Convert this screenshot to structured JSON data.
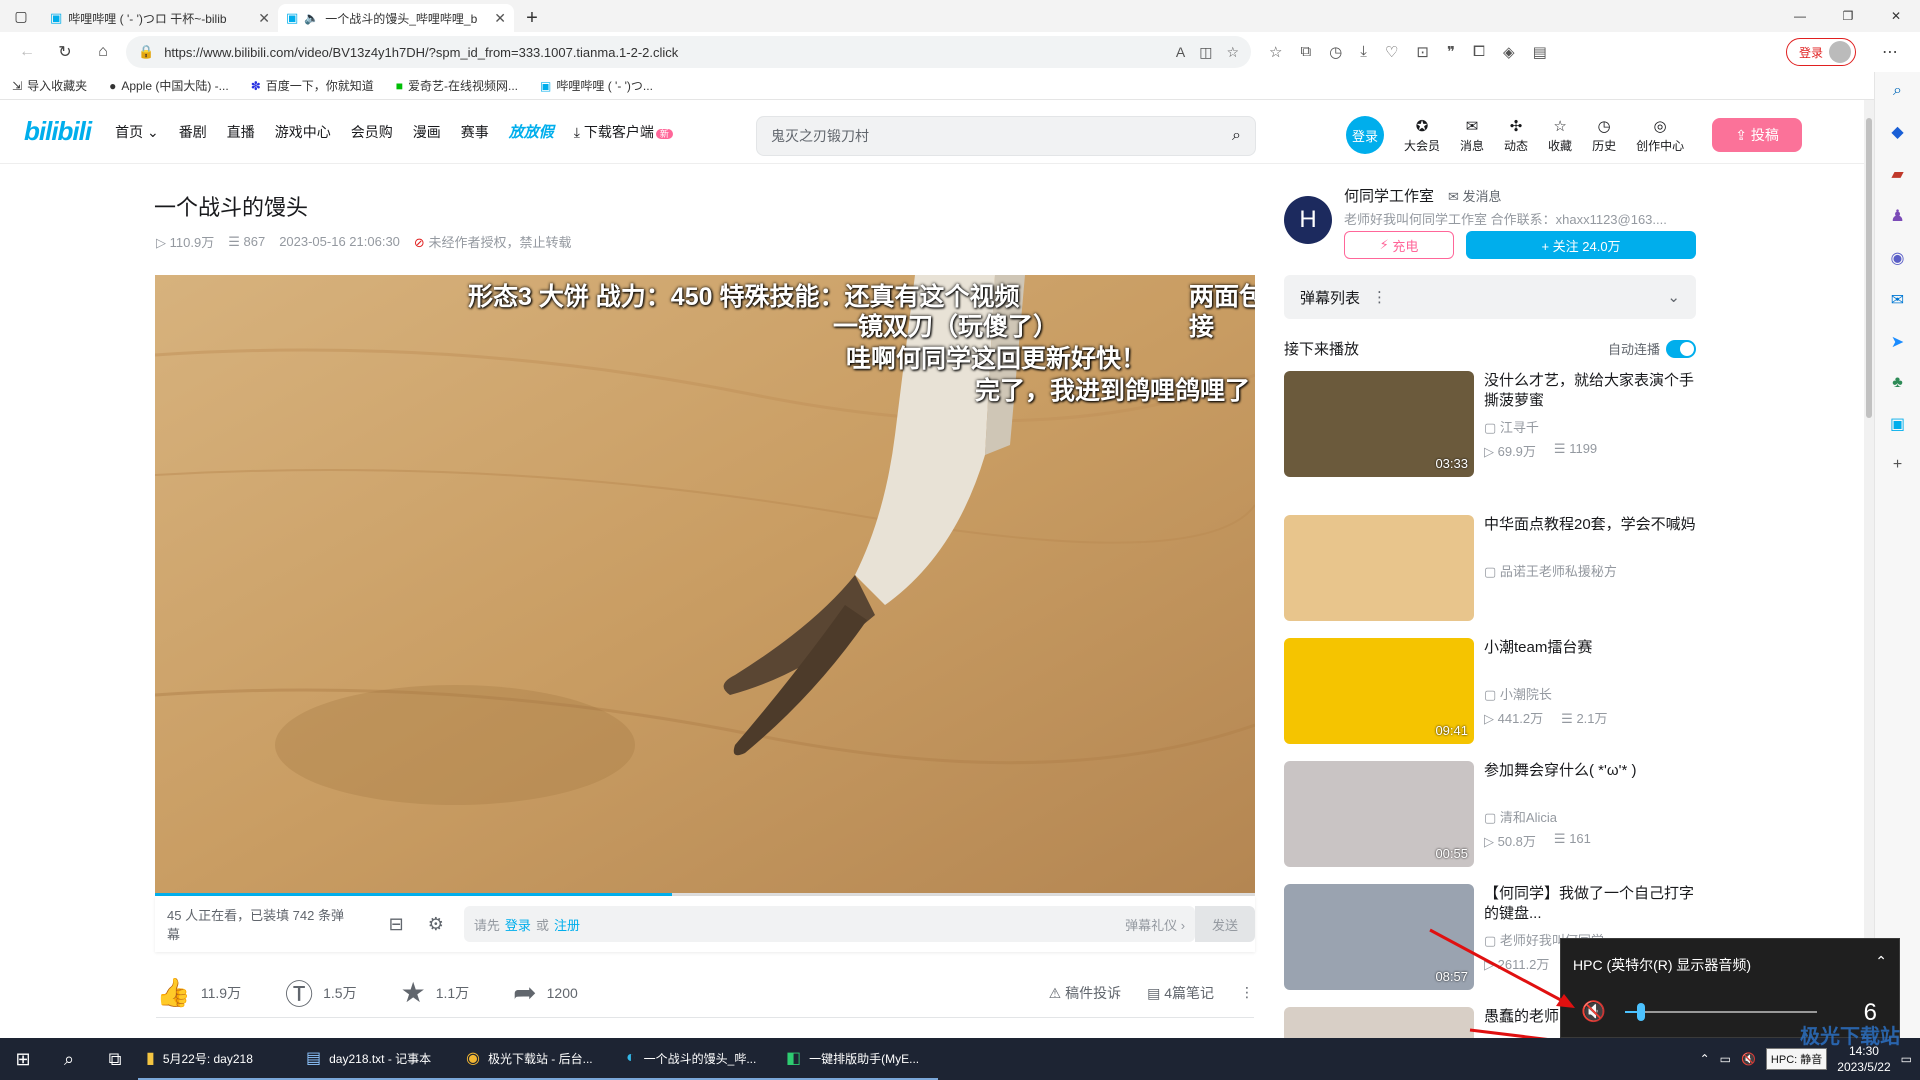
{
  "browser": {
    "tabs": [
      {
        "title": "哔哩哔哩 ( '- ')つロ 干杯~-bilib",
        "active": false
      },
      {
        "title": "一个战斗的馒头_哔哩哔哩_b",
        "active": true
      }
    ],
    "url": "https://www.bilibili.com/video/BV13z4y1h7DH/?spm_id_from=333.1007.tianma.1-2-2.click",
    "login_label": "登录",
    "favorites": [
      "导入收藏夹",
      "Apple (中国大陆) -...",
      "百度一下，你就知道",
      "爱奇艺-在线视频网...",
      "哔哩哔哩 ( '- ')つ..."
    ]
  },
  "site": {
    "logo": "bilibili",
    "nav": [
      "首页",
      "番剧",
      "直播",
      "游戏中心",
      "会员购",
      "漫画",
      "赛事"
    ],
    "festival": "放放假",
    "download": "下载客户端",
    "new_badge": "新",
    "search_placeholder": "鬼灭之刃锻刀村",
    "login_ball": "登录",
    "header_items": [
      "大会员",
      "消息",
      "动态",
      "收藏",
      "历史",
      "创作中心"
    ],
    "post_label": "投稿"
  },
  "video": {
    "title": "一个战斗的馒头",
    "views": "110.9万",
    "danmaku_count": "867",
    "date": "2023-05-16 21:06:30",
    "copyright": "未经作者授权，禁止转载",
    "subtitles": [
      "形态3 大饼 战力：450 特殊技能：还真有这个视频",
      "一镜双刀（玩傻了）",
      "哇啊何同学这回更新好快！",
      "完了，我进到鸽哩鸽哩了",
      "两面包",
      "接"
    ],
    "progress": 0.47,
    "watching": "45 人正在看，已装填 742 条弹幕",
    "dm_prompt": "请先",
    "dm_login": "登录",
    "dm_or": "或",
    "dm_register": "注册",
    "dm_etiquette": "弹幕礼仪 ›",
    "dm_send": "发送",
    "likes": "11.9万",
    "coins": "1.5万",
    "favs": "1.1万",
    "shares": "1200",
    "report": "稿件投诉",
    "notes": "4篇笔记"
  },
  "uploader": {
    "avatar_letter": "H",
    "name": "何同学工作室",
    "message": "发消息",
    "desc": "老师好我叫何同学工作室 合作联系：xhaxx1123@163....",
    "charge": "充电",
    "follow": "+ 关注 24.0万"
  },
  "sidebar": {
    "danmaku_list": "弹幕列表",
    "up_next": "接下来播放",
    "autoplay": "自动连播",
    "recs": [
      {
        "title": "没什么才艺，就给大家表演个手撕菠萝蜜",
        "author": "江寻千",
        "views": "69.9万",
        "danmaku": "1199",
        "duration": "03:33",
        "color": "#6b5a3c"
      },
      {
        "title": "中华面点教程20套，学会不喊妈",
        "author": "品诺王老师私援秘方",
        "views": "",
        "danmaku": "",
        "duration": "",
        "color": "#e8c58c"
      },
      {
        "title": "小潮team擂台赛",
        "author": "小潮院长",
        "views": "441.2万",
        "danmaku": "2.1万",
        "duration": "09:41",
        "color": "#f5c400"
      },
      {
        "title": "参加舞会穿什么( *'ω'* )",
        "author": "清和Alicia",
        "views": "50.8万",
        "danmaku": "161",
        "duration": "00:55",
        "color": "#c9c4c4"
      },
      {
        "title": "【何同学】我做了一个自己打字的键盘...",
        "author": "老师好我叫何同学",
        "views": "2611.2万",
        "danmaku": "",
        "duration": "08:57",
        "color": "#9aa3b0"
      },
      {
        "title": "愚蠢的老师...是因为懂得...",
        "author": "",
        "views": "",
        "danmaku": "",
        "duration": "",
        "color": "#d8cfc6"
      }
    ]
  },
  "volume": {
    "device": "HPC (英特尔(R) 显示器音频)",
    "value": "6",
    "level": 0.06
  },
  "taskbar": {
    "apps": [
      "5月22号: day218",
      "day218.txt - 记事本",
      "极光下载站 - 后台...",
      "一个战斗的馒头_哔...",
      "一键排版助手(MyE..."
    ],
    "hpc_tip": "HPC: 静音",
    "time": "14:30",
    "date": "2023/5/22"
  },
  "watermark": "极光下载站"
}
